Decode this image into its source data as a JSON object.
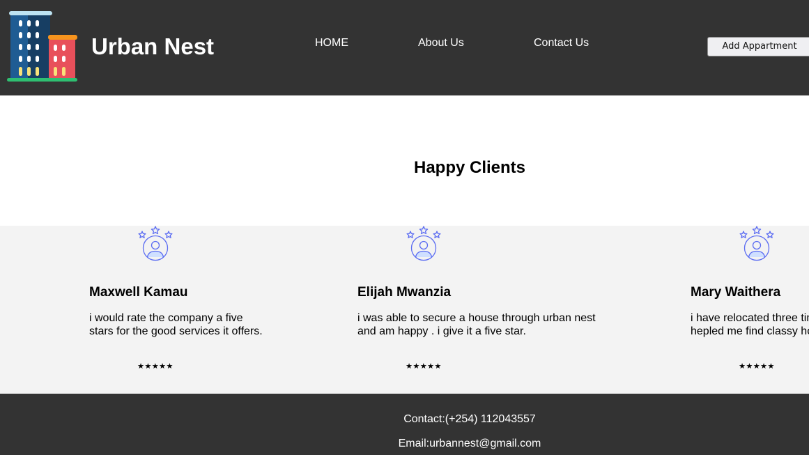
{
  "header": {
    "brand": "Urban Nest",
    "nav": {
      "home": "HOME",
      "about": "About Us",
      "contact": "Contact Us"
    },
    "add_button": "Add Appartment",
    "logo_icon": "apartment-buildings-icon"
  },
  "main": {
    "section_title": "Happy Clients",
    "testimonials": [
      {
        "name": "Maxwell Kamau",
        "review": "i would rate the company a five stars for the good services it offers.",
        "rating": 5,
        "stars": "★★★★★"
      },
      {
        "name": "Elijah Mwanzia",
        "review": "i was able to secure a house through urban nest and am happy . i give it a five star.",
        "rating": 5,
        "stars": "★★★★★"
      },
      {
        "name": "Mary Waithera",
        "review": "i have relocated three times and urban nest has hepled me find classy homes",
        "rating": 5,
        "stars": "★★★★★"
      }
    ],
    "avatar_icon": "user-with-stars-icon"
  },
  "footer": {
    "contact": "Contact:(+254) 112043557",
    "email": "Email:urbannest@gmail.com"
  },
  "colors": {
    "header_bg": "#333333",
    "testimonial_bg": "#f3f3f3",
    "icon_accent": "#5b6cf2"
  }
}
